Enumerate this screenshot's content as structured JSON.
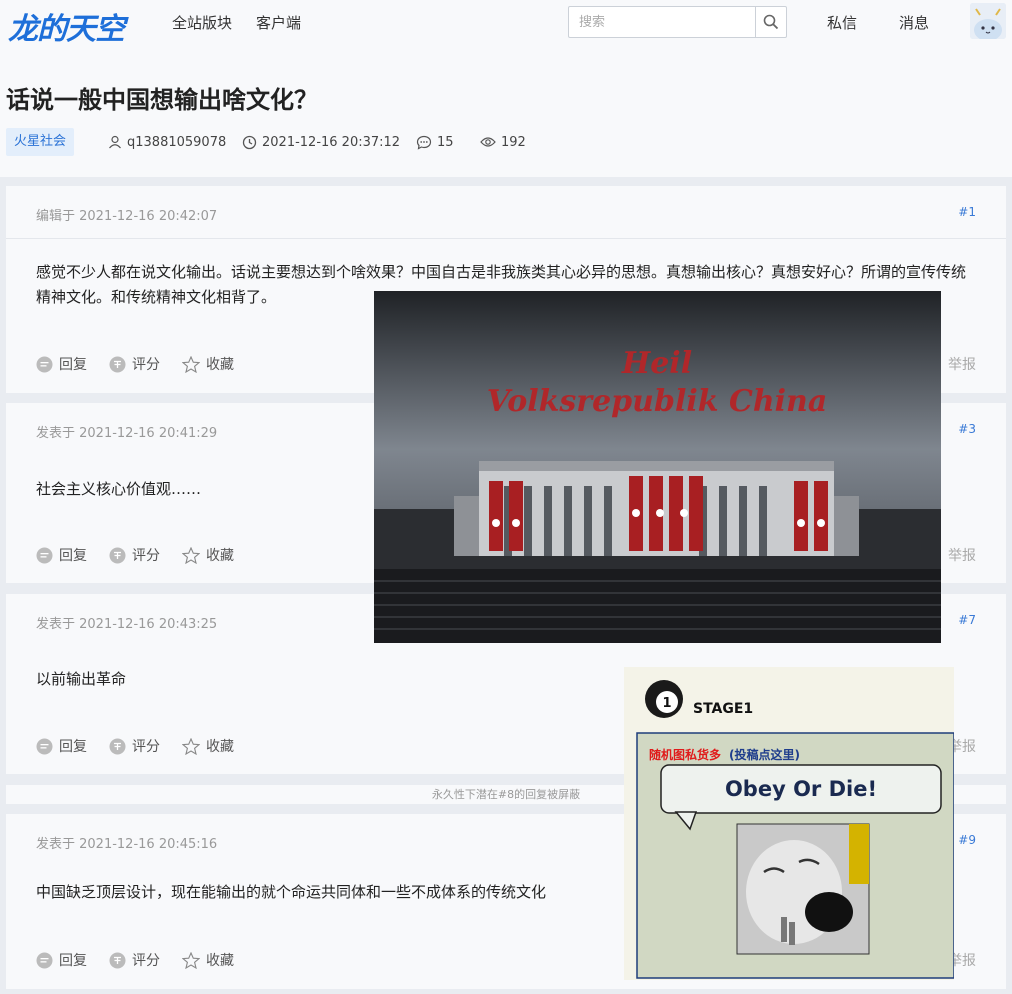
{
  "header": {
    "logo": "龙的天空",
    "nav": [
      "全站版块",
      "客户端"
    ],
    "search_placeholder": "搜索",
    "messages": "私信",
    "notifications": "消息"
  },
  "thread": {
    "title": "话说一般中国想输出啥文化？",
    "tag": "火星社会",
    "author": "q13881059078",
    "time": "2021-12-16 20:37:12",
    "replies": "15",
    "views": "192"
  },
  "posts": [
    {
      "when": "编辑于 2021-12-16 20:42:07",
      "floor": "#1",
      "content": "感觉不少人都在说文化输出。话说主要想达到个啥效果？中国自古是非我族类其心必异的思想。真想输出核心？真想安好心？所谓的宣传传统精神文化。和传统精神文化相背了。"
    },
    {
      "when": "发表于 2021-12-16 20:41:29",
      "floor": "#3",
      "content": "社会主义核心价值观……"
    },
    {
      "when": "发表于 2021-12-16 20:43:25",
      "floor": "#7",
      "content": "以前输出革命"
    },
    {
      "when": "发表于 2021-12-16 20:45:16",
      "floor": "#9",
      "content": "中国缺乏顶层设计，现在能输出的就个命运共同体和一些不成体系的传统文化"
    }
  ],
  "actions": {
    "reply": "回复",
    "rate": "评分",
    "favorite": "收藏",
    "report": "举报"
  },
  "hidden_note": "永久性下潜在#8的回复被屏蔽",
  "image1": {
    "line1": "Heil",
    "line2": "Volksrepublik China"
  },
  "image2": {
    "stage": "STAGE1",
    "stage_num": "1",
    "caption_red": "随机图私货多",
    "caption_blue": "(投稿点这里)",
    "bubble": "Obey Or Die!"
  },
  "colors": {
    "accent": "#1e6fd9",
    "tag_bg": "#e3eefb",
    "floor": "#3a7ad6"
  }
}
